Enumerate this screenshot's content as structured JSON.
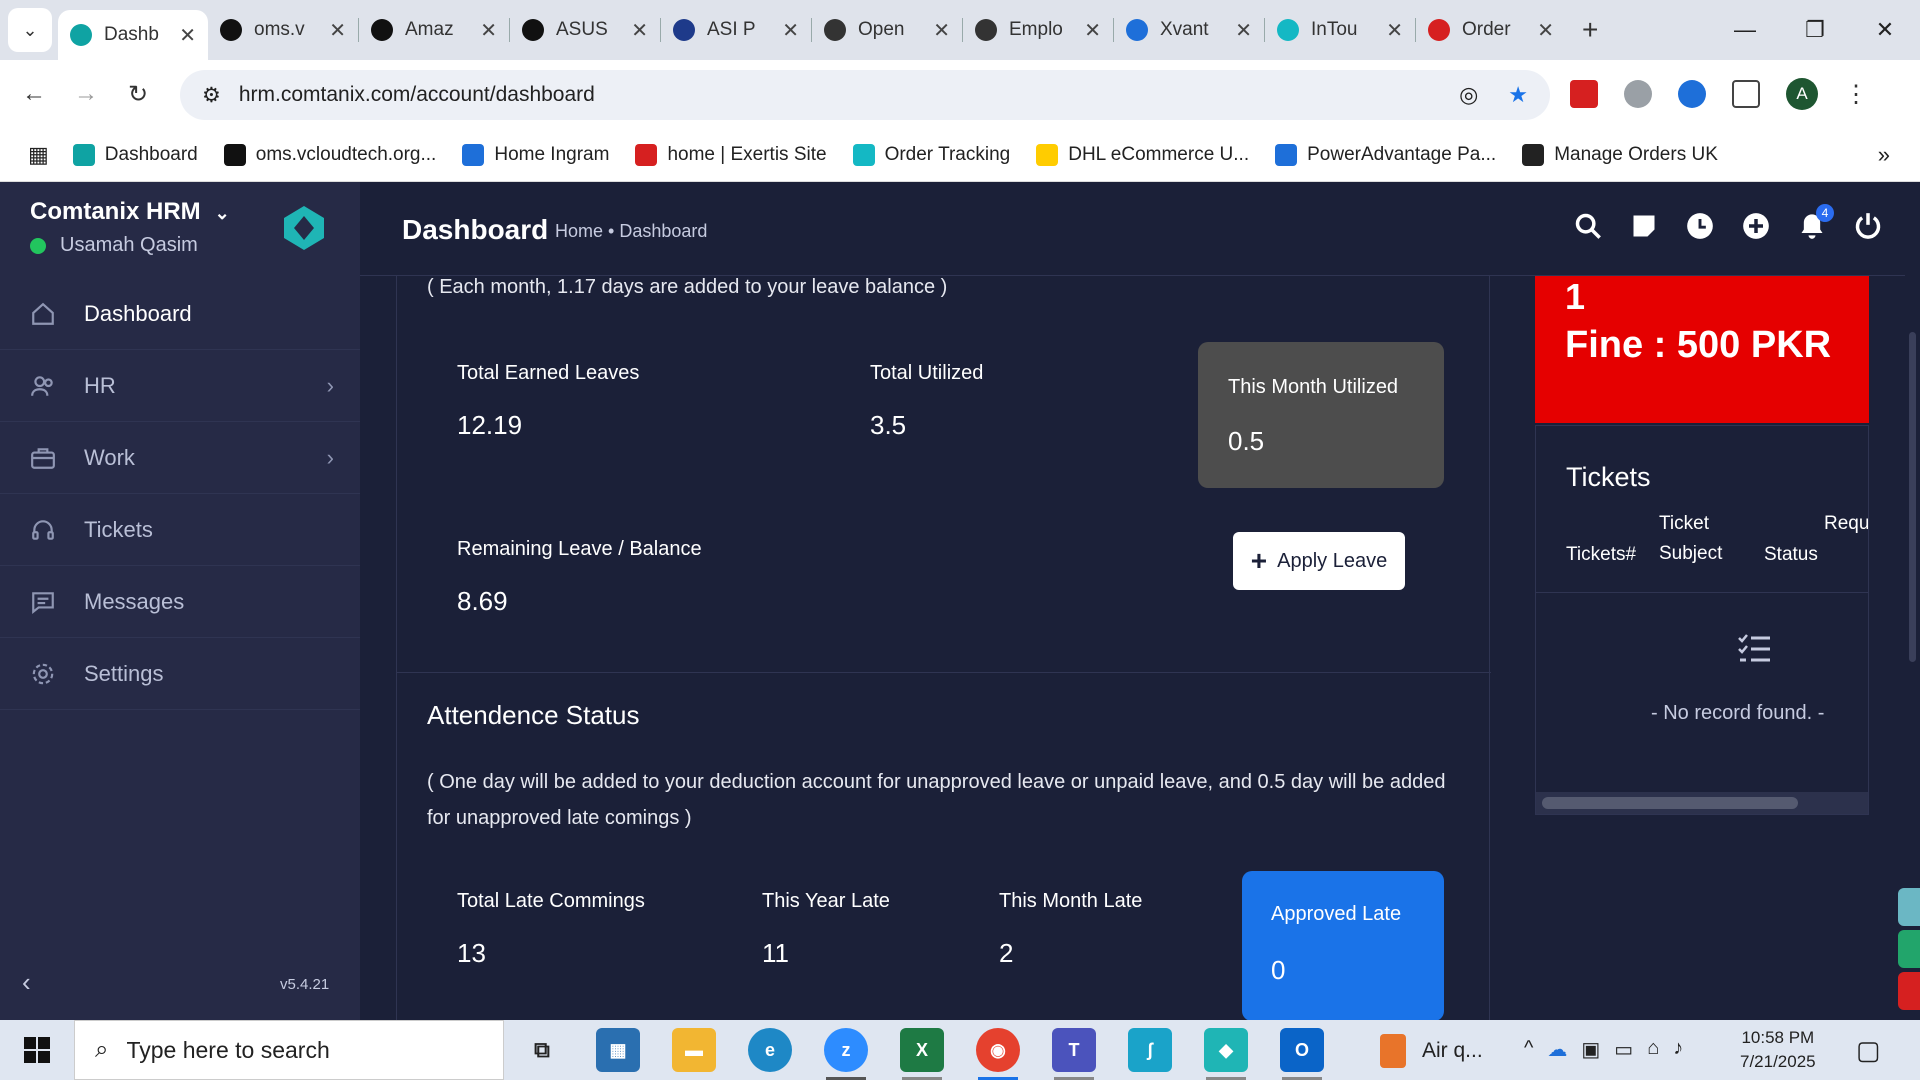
{
  "browser": {
    "tabs": [
      {
        "label": "Dashb",
        "active": true,
        "color": "#0fa3a3"
      },
      {
        "label": "oms.v",
        "color": "#111111"
      },
      {
        "label": "Amaz",
        "color": "#111111"
      },
      {
        "label": "ASUS",
        "color": "#111111"
      },
      {
        "label": "ASI P",
        "color": "#1e3a8a"
      },
      {
        "label": "Open",
        "color": "#333333"
      },
      {
        "label": "Emplo",
        "color": "#333333"
      },
      {
        "label": "Xvant",
        "color": "#1e6fd9"
      },
      {
        "label": "InTou",
        "color": "#14b8c4"
      },
      {
        "label": "Order",
        "color": "#d62020"
      }
    ],
    "url": "hrm.comtanix.com/account/dashboard",
    "profile_initial": "A",
    "bookmarks": [
      {
        "label": "Dashboard",
        "color": "#0fa3a3"
      },
      {
        "label": "oms.vcloudtech.org...",
        "color": "#111111"
      },
      {
        "label": "Home Ingram",
        "color": "#1e6fd9"
      },
      {
        "label": "home | Exertis Site",
        "color": "#d62020"
      },
      {
        "label": "Order Tracking",
        "color": "#14b8c4"
      },
      {
        "label": "DHL eCommerce U...",
        "color": "#ffcc00"
      },
      {
        "label": "PowerAdvantage Pa...",
        "color": "#1e6fd9"
      },
      {
        "label": "Manage Orders UK",
        "color": "#222222"
      }
    ]
  },
  "app": {
    "brand": "Comtanix HRM",
    "user": "Usamah Qasim",
    "version": "v5.4.21",
    "nav": [
      {
        "label": "Dashboard",
        "icon": "home-icon",
        "active": true
      },
      {
        "label": "HR",
        "icon": "users-icon",
        "chevron": true
      },
      {
        "label": "Work",
        "icon": "briefcase-icon",
        "chevron": true
      },
      {
        "label": "Tickets",
        "icon": "headset-icon"
      },
      {
        "label": "Messages",
        "icon": "message-icon"
      },
      {
        "label": "Settings",
        "icon": "gear-icon"
      }
    ],
    "header": {
      "title": "Dashboard",
      "breadcrumb": "Home • Dashboard",
      "notification_count": "4"
    }
  },
  "leave": {
    "note": "( Each month, 1.17 days are added to your leave balance )",
    "total_earned_label": "Total Earned Leaves",
    "total_earned_value": "12.19",
    "total_utilized_label": "Total Utilized",
    "total_utilized_value": "3.5",
    "this_month_label": "This Month Utilized",
    "this_month_value": "0.5",
    "remaining_label": "Remaining Leave / Balance",
    "remaining_value": "8.69",
    "apply_button": "Apply Leave"
  },
  "attendance": {
    "title": "Attendence Status",
    "note": "( One day will be added to your deduction account for unapproved leave or unpaid leave, and 0.5 day will be added for unapproved late comings )",
    "late_total_label": "Total Late Commings",
    "late_total_value": "13",
    "year_late_label": "This Year Late",
    "year_late_value": "11",
    "month_late_label": "This Month Late",
    "month_late_value": "2",
    "approved_label": "Approved Late",
    "approved_value": "0"
  },
  "fine": {
    "count": "1",
    "text": "Fine : 500 PKR",
    "color": "#e50000"
  },
  "tickets": {
    "title": "Tickets",
    "col1": "Tickets#",
    "col2_line1": "Ticket",
    "col2_line2": "Subject",
    "col3": "Status",
    "col4": "Requ",
    "empty": "- No record found. -"
  },
  "taskbar": {
    "search_placeholder": "Type here to search",
    "weather": "Air q...",
    "time": "10:58 PM",
    "date": "7/21/2025"
  }
}
